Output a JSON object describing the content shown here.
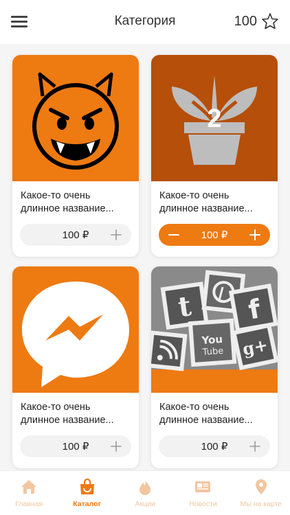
{
  "header": {
    "title": "Категория",
    "points": "100"
  },
  "products": [
    {
      "name": "Какое-то очень длинное название...",
      "price": "100 ₽",
      "quantity": null,
      "image": "devil-emoji-icon"
    },
    {
      "name": "Какое-то очень длинное название...",
      "price": "100 ₽",
      "quantity": "2",
      "image": "plant-pot-icon"
    },
    {
      "name": "Какое-то очень длинное название...",
      "price": "100 ₽",
      "quantity": null,
      "image": "messenger-icon"
    },
    {
      "name": "Какое-то очень длинное название...",
      "price": "100 ₽",
      "quantity": null,
      "image": "social-icons-photo"
    }
  ],
  "tabs": [
    {
      "label": "Главная",
      "icon": "home-icon",
      "active": false
    },
    {
      "label": "Каталог",
      "icon": "shopping-bag-icon",
      "active": true
    },
    {
      "label": "Акции",
      "icon": "flame-icon",
      "active": false
    },
    {
      "label": "Новости",
      "icon": "newspaper-icon",
      "active": false
    },
    {
      "label": "Мы на карте",
      "icon": "map-pin-icon",
      "active": false
    }
  ],
  "colors": {
    "accent": "#ee7a12",
    "accent_light": "#f2c6a0",
    "card_orange": "#ee7a12",
    "card_dark_orange": "#b54f0a"
  }
}
